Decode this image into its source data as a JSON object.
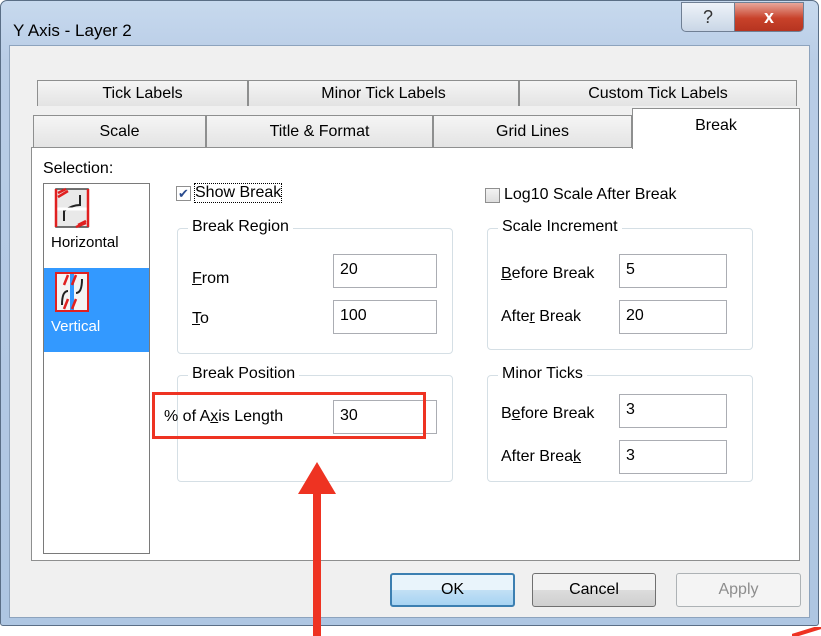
{
  "window": {
    "title": "Y Axis - Layer 2",
    "help_label": "?",
    "close_label": "x"
  },
  "tabs": {
    "row1": [
      {
        "label": "Tick Labels"
      },
      {
        "label": "Minor Tick Labels"
      },
      {
        "label": "Custom Tick Labels"
      }
    ],
    "row2": [
      {
        "label": "Scale"
      },
      {
        "label": "Title & Format"
      },
      {
        "label": "Grid Lines"
      },
      {
        "label": "Break",
        "active": true
      }
    ]
  },
  "selection": {
    "label": "Selection:",
    "items": [
      {
        "label": "Horizontal",
        "icon": "horizontal-break-icon",
        "selected": false
      },
      {
        "label": "Vertical",
        "icon": "vertical-break-icon",
        "selected": true
      }
    ]
  },
  "show_break": {
    "label": "Show Break",
    "checked": true
  },
  "log10": {
    "label": "Log10 Scale After Break",
    "checked": false
  },
  "break_region": {
    "title": "Break Region",
    "from_label": "From",
    "from_value": "20",
    "to_label": "To",
    "to_value": "100"
  },
  "break_position": {
    "title": "Break Position",
    "axis_length_label": "% of Axis Length",
    "axis_length_value": "30"
  },
  "scale_increment": {
    "title": "Scale Increment",
    "before_label": "Before Break",
    "before_value": "5",
    "after_label": "After Break",
    "after_value": "20"
  },
  "minor_ticks": {
    "title": "Minor Ticks",
    "before_label": "Before Break",
    "before_value": "3",
    "after_label": "After Break",
    "after_value": "3"
  },
  "buttons": {
    "ok": "OK",
    "cancel": "Cancel",
    "apply": "Apply"
  },
  "colors": {
    "annotation": "#ee3322",
    "selection_highlight": "#3399ff",
    "title_bar": "#c7d9ee"
  }
}
